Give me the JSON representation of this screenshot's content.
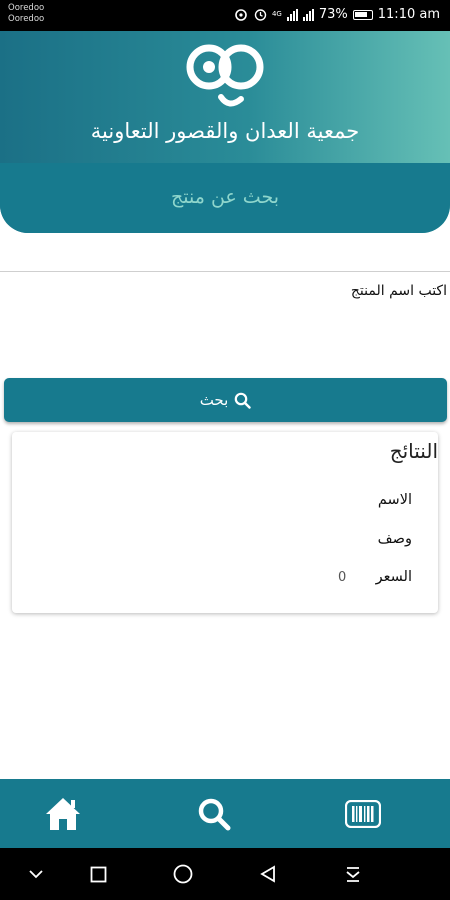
{
  "status_bar": {
    "carrier_1": "Ooredoo",
    "carrier_2": "Ooredoo",
    "network": "4G",
    "battery": "73%",
    "time": "11:10 am"
  },
  "header": {
    "title": "جمعية العدان والقصور التعاونية",
    "subtitle": "بحث عن منتج",
    "gradient_colors": [
      "#1b7086",
      "#66c0b6"
    ]
  },
  "search": {
    "label": "اكتب اسم المنتج",
    "input_value": "",
    "placeholder": "",
    "button_label": "بحث"
  },
  "results": {
    "title": "النتائج",
    "name_label": "الاسم",
    "description_label": "وصف",
    "price_label": "السعر",
    "price_value": "0"
  },
  "bottom_nav": {
    "items": [
      "home-icon",
      "search-icon",
      "barcode-icon"
    ]
  },
  "colors": {
    "primary": "#177a8e",
    "accent_text": "#8fd6cc"
  }
}
